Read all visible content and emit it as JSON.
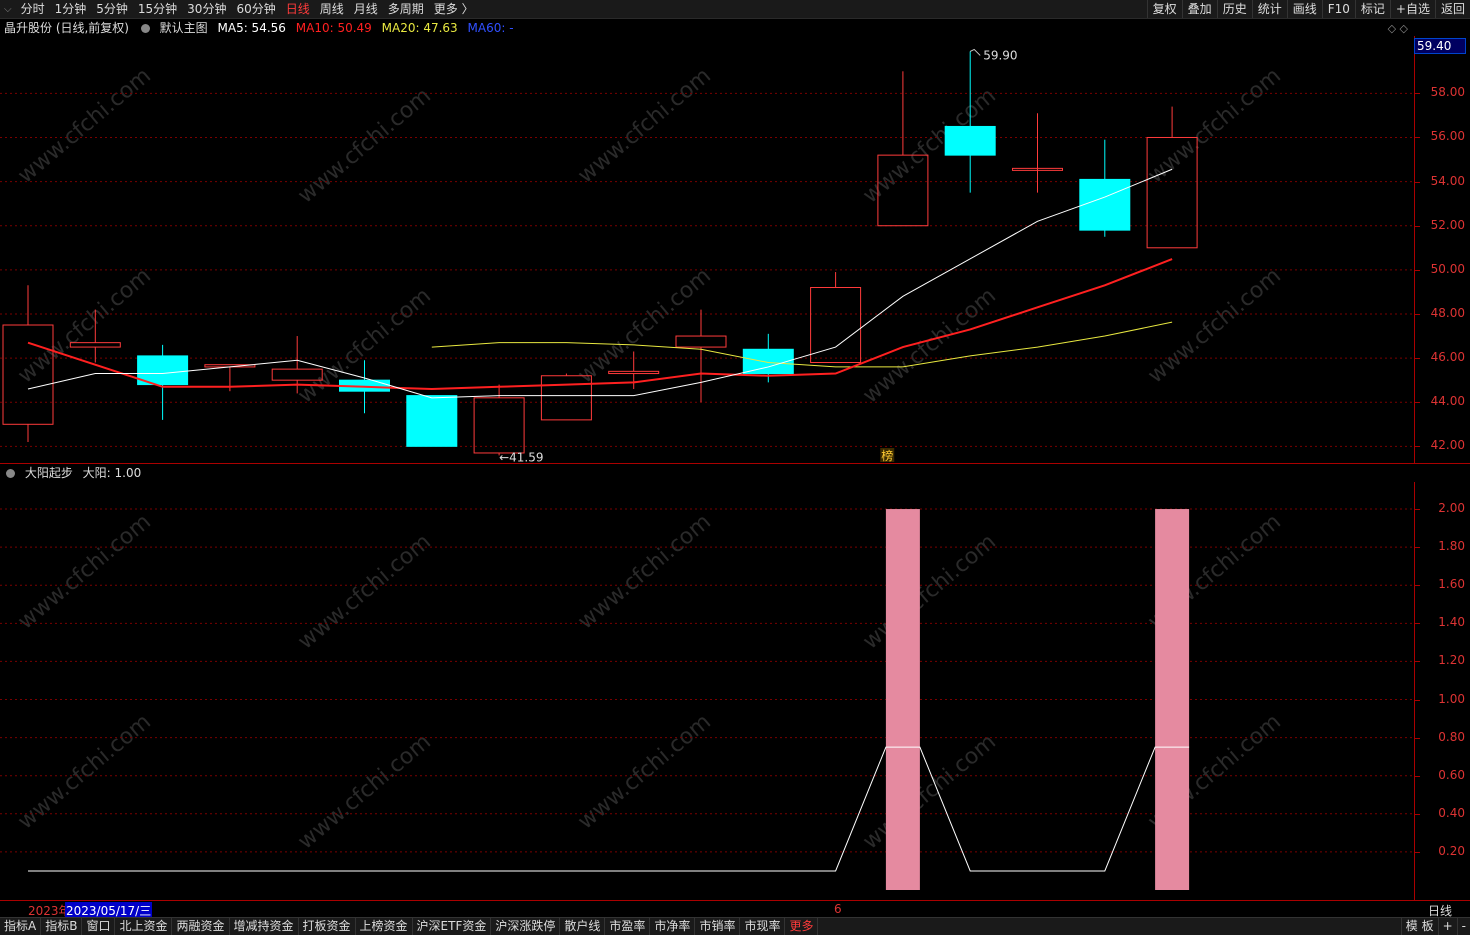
{
  "topbar": {
    "tabs": [
      "分时",
      "1分钟",
      "5分钟",
      "15分钟",
      "30分钟",
      "60分钟",
      "日线",
      "周线",
      "月线",
      "多周期",
      "更多 〉"
    ],
    "active_index": 6,
    "right_buttons": [
      "复权",
      "叠加",
      "历史",
      "统计",
      "画线",
      "F10",
      "标记",
      "+自选",
      "返回"
    ]
  },
  "main_info": {
    "stock": "晶升股份 (日线,前复权)",
    "template": "默认主图",
    "ma5": "MA5: 54.56",
    "ma10": "MA10: 50.49",
    "ma20": "MA20: 47.63",
    "ma60": "MA60: -"
  },
  "sub_info": {
    "indicator": "大阳起步",
    "value": "大阳: 1.00"
  },
  "colors": {
    "up": "#ff3b3b",
    "down": "#00ffff",
    "ma5": "#ffffff",
    "ma10": "#ff2020",
    "ma20": "#e8e840",
    "ma60": "#2040ff",
    "bar": "#e58aa0",
    "grid": "#7a0000",
    "axis_text": "#d33333"
  },
  "price_tag": "59.40",
  "annotations": {
    "high": "59.90",
    "low": "←41.59",
    "marker": "榜"
  },
  "main_axis": {
    "labels": [
      "58.00",
      "56.00",
      "54.00",
      "52.00",
      "50.00",
      "48.00",
      "46.00",
      "44.00",
      "42.00"
    ]
  },
  "sub_axis": {
    "labels": [
      "2.00",
      "1.80",
      "1.60",
      "1.40",
      "1.20",
      "1.00",
      "0.80",
      "0.60",
      "0.40",
      "0.20"
    ]
  },
  "watermark": "www.cfchi.com",
  "chart_data": {
    "type": "candlestick",
    "ylim": [
      41.2,
      60.6
    ],
    "candles": [
      {
        "o": 43.0,
        "h": 49.3,
        "l": 42.2,
        "c": 47.5
      },
      {
        "o": 46.5,
        "h": 48.2,
        "l": 45.8,
        "c": 46.7
      },
      {
        "o": 46.1,
        "h": 46.6,
        "l": 43.2,
        "c": 44.8
      },
      {
        "o": 45.6,
        "h": 45.7,
        "l": 44.5,
        "c": 45.7
      },
      {
        "o": 45.0,
        "h": 47.0,
        "l": 44.4,
        "c": 45.5
      },
      {
        "o": 45.0,
        "h": 45.9,
        "l": 43.5,
        "c": 44.5
      },
      {
        "o": 44.3,
        "h": 44.3,
        "l": 42.0,
        "c": 42.0
      },
      {
        "o": 41.7,
        "h": 44.8,
        "l": 41.59,
        "c": 44.2
      },
      {
        "o": 43.2,
        "h": 45.3,
        "l": 43.2,
        "c": 45.2
      },
      {
        "o": 45.3,
        "h": 46.3,
        "l": 44.6,
        "c": 45.4
      },
      {
        "o": 46.5,
        "h": 48.2,
        "l": 44.0,
        "c": 47.0
      },
      {
        "o": 46.4,
        "h": 47.1,
        "l": 44.9,
        "c": 45.3
      },
      {
        "o": 45.8,
        "h": 49.9,
        "l": 45.8,
        "c": 49.2
      },
      {
        "o": 52.0,
        "h": 59.0,
        "l": 52.0,
        "c": 55.2
      },
      {
        "o": 56.5,
        "h": 59.9,
        "l": 53.5,
        "c": 55.2
      },
      {
        "o": 54.6,
        "h": 57.1,
        "l": 53.5,
        "c": 54.6
      },
      {
        "o": 54.1,
        "h": 55.9,
        "l": 51.5,
        "c": 51.8
      },
      {
        "o": 51.0,
        "h": 57.4,
        "l": 51.0,
        "c": 56.0
      }
    ],
    "ma5": [
      44.6,
      45.3,
      45.3,
      45.6,
      45.9,
      45.1,
      44.2,
      44.3,
      44.3,
      44.3,
      44.9,
      45.6,
      46.5,
      48.8,
      50.5,
      52.2,
      53.3,
      54.56
    ],
    "ma10": [
      46.7,
      null,
      44.7,
      44.7,
      44.8,
      44.7,
      44.6,
      44.7,
      44.8,
      44.9,
      45.3,
      45.2,
      45.3,
      46.5,
      47.3,
      48.3,
      49.3,
      50.49
    ],
    "ma20": [
      null,
      null,
      null,
      null,
      null,
      null,
      46.5,
      46.7,
      46.7,
      46.6,
      46.4,
      45.8,
      45.6,
      45.6,
      46.1,
      46.5,
      47.0,
      47.63
    ],
    "sub_chart": {
      "type": "bar",
      "ylim": [
        0,
        2.1
      ],
      "bars": [
        0,
        0,
        0,
        0,
        0,
        0,
        0,
        0,
        0,
        0,
        0,
        0,
        0,
        2.0,
        0,
        0,
        0,
        2.0
      ],
      "line": [
        0.1,
        0.1,
        0.1,
        0.1,
        0.1,
        0.1,
        0.1,
        0.1,
        0.1,
        0.1,
        0.1,
        0.1,
        0.1,
        0.75,
        0.1,
        0.1,
        0.1,
        0.75
      ]
    }
  },
  "date_row": {
    "year": "2023年",
    "date": "2023/05/17/三",
    "marker": "6",
    "period": "日线"
  },
  "bottombar": {
    "tabs": [
      "指标A",
      "指标B",
      "窗口",
      "北上资金",
      "两融资金",
      "增减持资金",
      "打板资金",
      "上榜资金",
      "沪深ETF资金",
      "沪深涨跌停",
      "散户线",
      "市盈率",
      "市净率",
      "市销率",
      "市现率",
      "更多"
    ],
    "active_index": 15,
    "right": [
      "模 板",
      "+",
      "-"
    ]
  }
}
